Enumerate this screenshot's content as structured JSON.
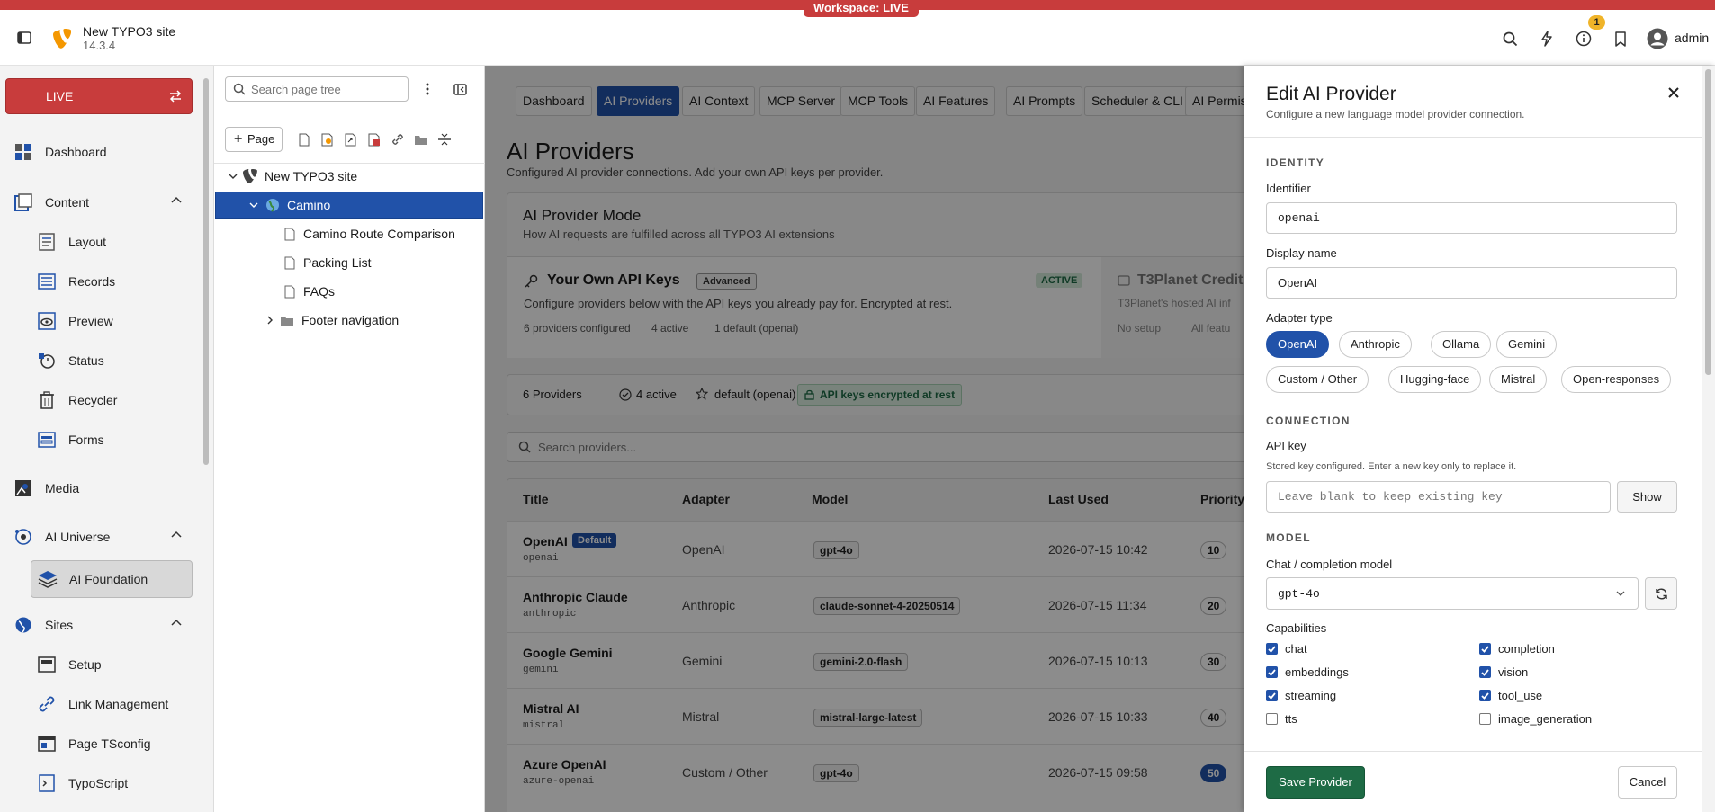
{
  "workspace": {
    "label": "Workspace: LIVE"
  },
  "topbar": {
    "site_name": "New TYPO3 site",
    "version": "14.3.4",
    "notification_count": "1",
    "user": "admin"
  },
  "modnav": {
    "live_label": "LIVE",
    "items": [
      {
        "label": "Dashboard"
      },
      {
        "label": "Content"
      },
      {
        "label": "Layout"
      },
      {
        "label": "Records"
      },
      {
        "label": "Preview"
      },
      {
        "label": "Status"
      },
      {
        "label": "Recycler"
      },
      {
        "label": "Forms"
      },
      {
        "label": "Media"
      },
      {
        "label": "AI Universe"
      },
      {
        "label": "AI Foundation"
      },
      {
        "label": "Sites"
      },
      {
        "label": "Setup"
      },
      {
        "label": "Link Management"
      },
      {
        "label": "Page TSconfig"
      },
      {
        "label": "TypoScript"
      }
    ]
  },
  "pagetree": {
    "search_placeholder": "Search page tree",
    "new_page_label": "Page",
    "nodes": [
      {
        "label": "New TYPO3 site"
      },
      {
        "label": "Camino"
      },
      {
        "label": "Camino Route Comparison"
      },
      {
        "label": "Packing List"
      },
      {
        "label": "FAQs"
      },
      {
        "label": "Footer navigation"
      }
    ]
  },
  "tabs": [
    {
      "label": "Dashboard"
    },
    {
      "label": "AI Providers"
    },
    {
      "label": "AI Context"
    },
    {
      "label": "MCP Server"
    },
    {
      "label": "MCP Tools"
    },
    {
      "label": "AI Features"
    },
    {
      "label": "AI Prompts"
    },
    {
      "label": "Scheduler & CLI"
    },
    {
      "label": "AI Permis"
    }
  ],
  "main": {
    "title": "AI Providers",
    "subtitle": "Configured AI provider connections. Add your own API keys per provider.",
    "mode": {
      "title": "AI Provider Mode",
      "subtitle": "How AI requests are fulfilled across all TYPO3 AI extensions",
      "own_keys": {
        "title": "Your Own API Keys",
        "badge": "Advanced",
        "status": "ACTIVE",
        "desc": "Configure providers below with the API keys you already pay for. Encrypted at rest.",
        "meta1": "6 providers configured",
        "meta2": "4 active",
        "meta3": "1 default (openai)"
      },
      "t3planet": {
        "title": "T3Planet Credit",
        "desc": "T3Planet's hosted AI inf",
        "meta1": "No setup",
        "meta2": "All featu"
      }
    },
    "stats": {
      "providers": "6 Providers",
      "active": "4 active",
      "default": "default (openai)",
      "encrypted": "API keys encrypted at rest"
    },
    "search_placeholder": "Search providers...",
    "table": {
      "headers": [
        "Title",
        "Adapter",
        "Model",
        "Last Used",
        "Priority"
      ],
      "rows": [
        {
          "title": "OpenAI",
          "badge": "Default",
          "ident": "openai",
          "adapter": "OpenAI",
          "model": "gpt-4o",
          "last_used": "2026-07-15 10:42",
          "priority": "10"
        },
        {
          "title": "Anthropic Claude",
          "badge": "",
          "ident": "anthropic",
          "adapter": "Anthropic",
          "model": "claude-sonnet-4-20250514",
          "last_used": "2026-07-15 11:34",
          "priority": "20"
        },
        {
          "title": "Google Gemini",
          "badge": "",
          "ident": "gemini",
          "adapter": "Gemini",
          "model": "gemini-2.0-flash",
          "last_used": "2026-07-15 10:13",
          "priority": "30"
        },
        {
          "title": "Mistral AI",
          "badge": "",
          "ident": "mistral",
          "adapter": "Mistral",
          "model": "mistral-large-latest",
          "last_used": "2026-07-15 10:33",
          "priority": "40"
        },
        {
          "title": "Azure OpenAI",
          "badge": "",
          "ident": "azure-openai",
          "adapter": "Custom / Other",
          "model": "gpt-4o",
          "last_used": "2026-07-15 09:58",
          "priority": "50"
        }
      ]
    }
  },
  "panel": {
    "title": "Edit AI Provider",
    "subtitle": "Configure a new language model provider connection.",
    "identity_heading": "IDENTITY",
    "identifier_label": "Identifier",
    "identifier_value": "openai",
    "display_label": "Display name",
    "display_value": "OpenAI",
    "adapter_label": "Adapter type",
    "adapters": [
      "OpenAI",
      "Anthropic",
      "Ollama",
      "Gemini",
      "Custom / Other",
      "Hugging-face",
      "Mistral",
      "Open-responses"
    ],
    "connection_heading": "CONNECTION",
    "apikey_label": "API key",
    "apikey_help": "Stored key configured. Enter a new key only to replace it.",
    "apikey_placeholder": "Leave blank to keep existing key",
    "show_label": "Show",
    "model_heading": "MODEL",
    "chat_model_label": "Chat / completion model",
    "chat_model_value": "gpt-4o",
    "capabilities_label": "Capabilities",
    "capabilities": [
      {
        "label": "chat",
        "checked": true
      },
      {
        "label": "completion",
        "checked": true
      },
      {
        "label": "embeddings",
        "checked": true
      },
      {
        "label": "vision",
        "checked": true
      },
      {
        "label": "streaming",
        "checked": true
      },
      {
        "label": "tool_use",
        "checked": true
      },
      {
        "label": "tts",
        "checked": false
      },
      {
        "label": "image_generation",
        "checked": false
      }
    ],
    "save_label": "Save Provider",
    "cancel_label": "Cancel"
  },
  "colors": {
    "brand": "#f49700",
    "live": "#c83c3c",
    "primary": "#2152a9",
    "success": "#1e6b45"
  }
}
